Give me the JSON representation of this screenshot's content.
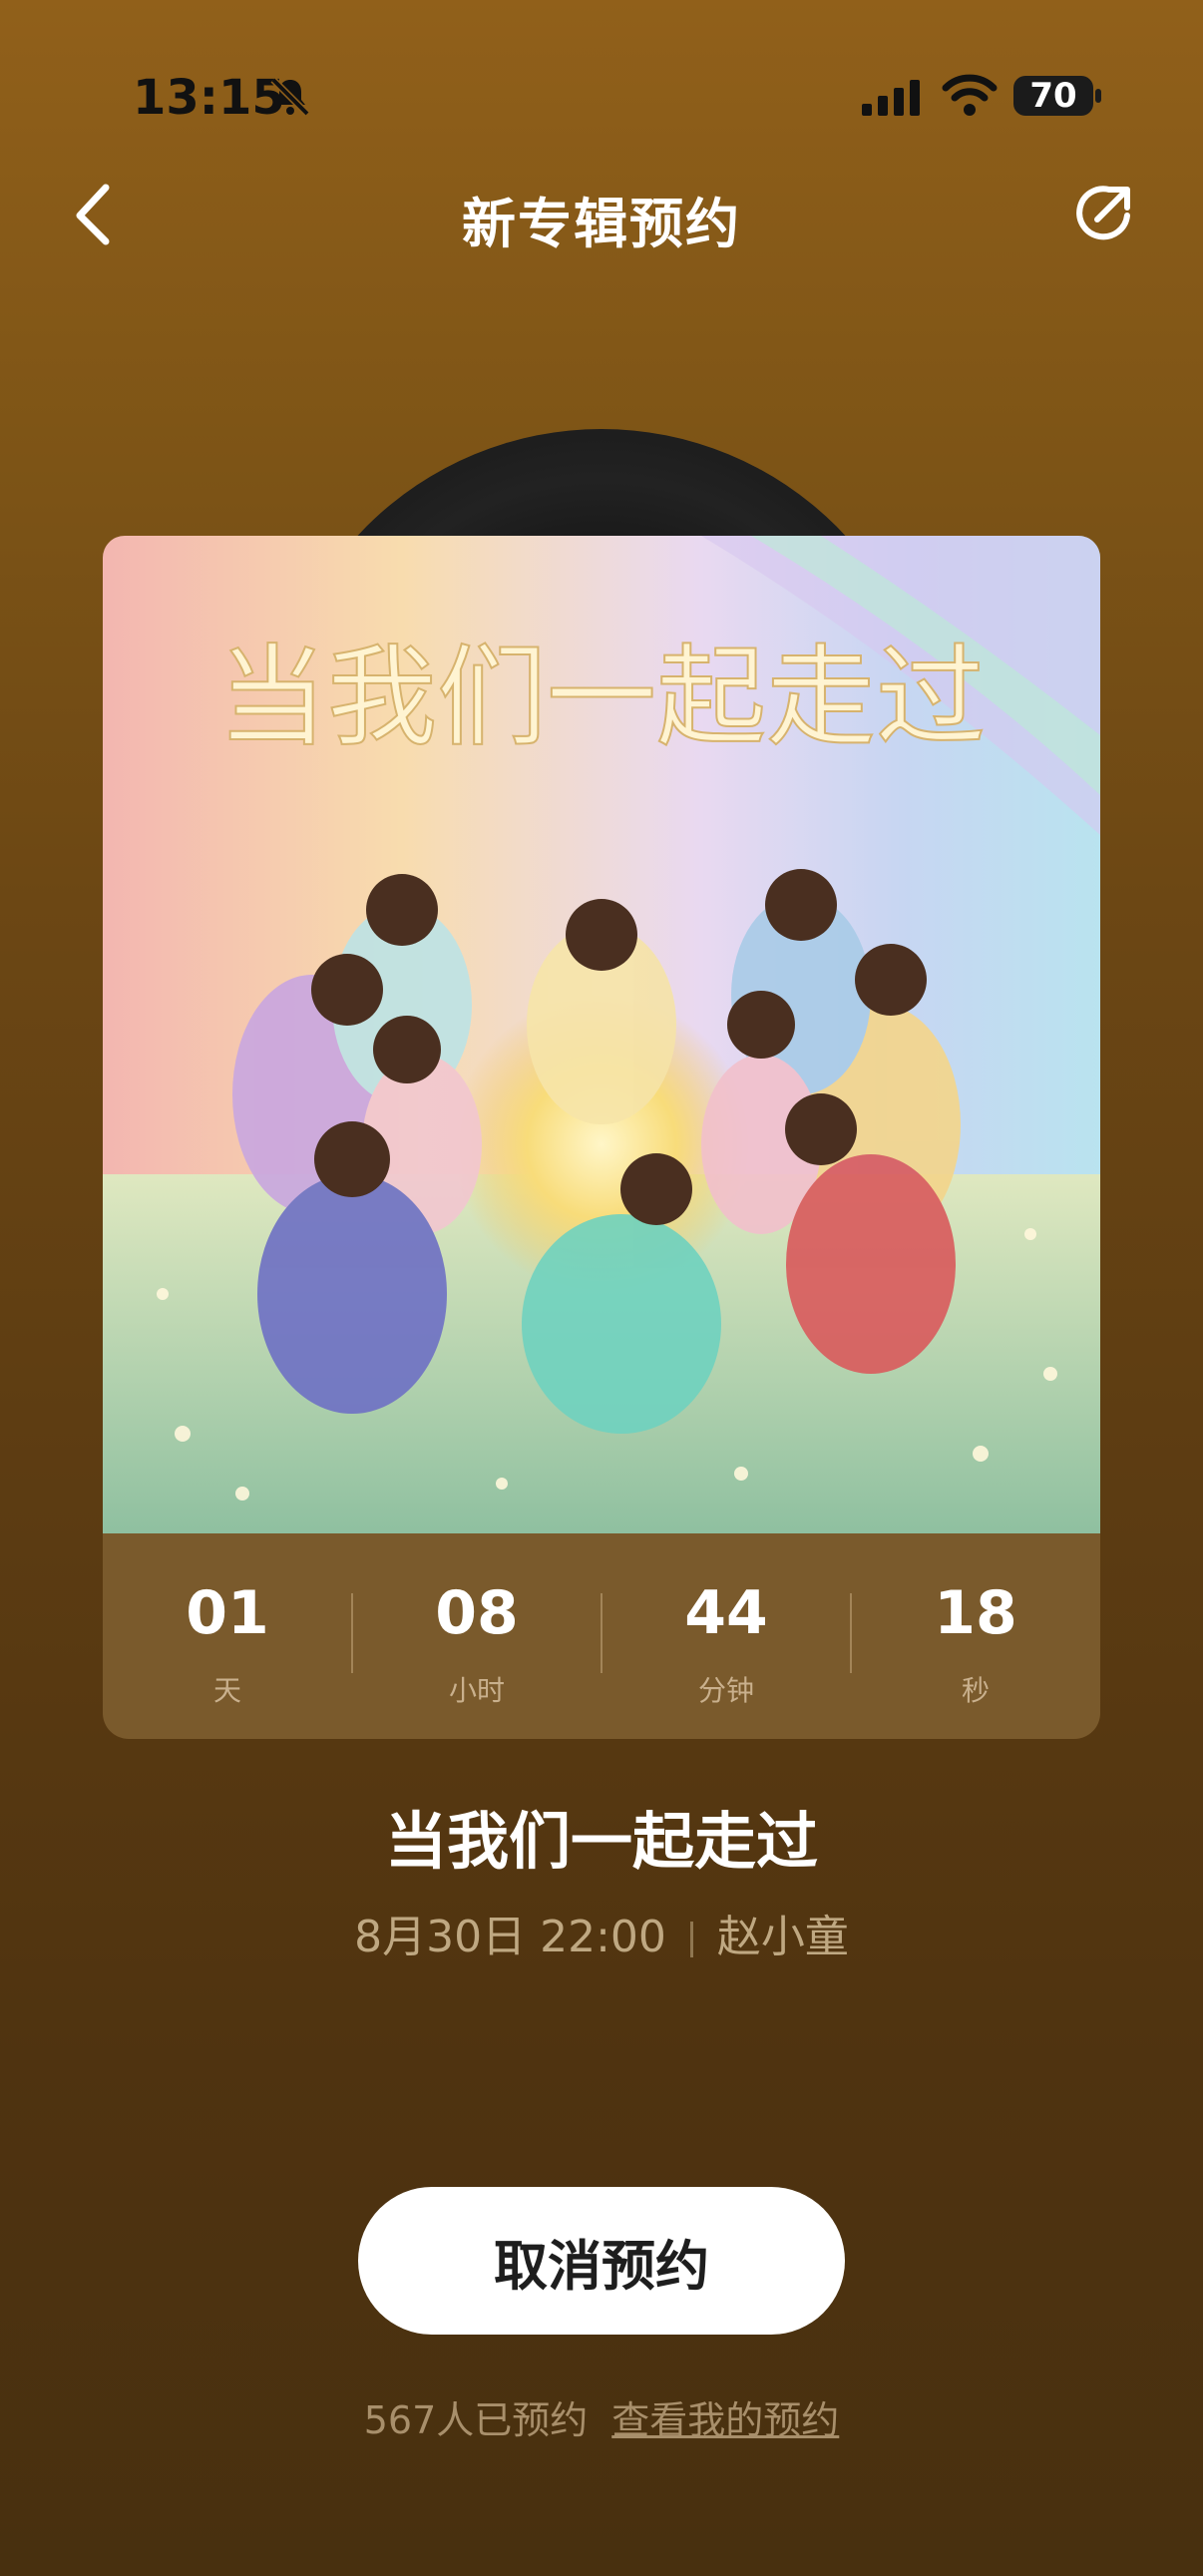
{
  "status_bar": {
    "time": "13:15",
    "battery": "70",
    "bell_icon": "bell-muted-icon",
    "signal_icon": "signal-icon",
    "wifi_icon": "wifi-icon"
  },
  "nav": {
    "title": "新专辑预约",
    "back_icon": "chevron-left-icon",
    "share_icon": "share-icon"
  },
  "album": {
    "cover_title": "当我们一起走过",
    "title": "当我们一起走过",
    "release": "8月30日 22:00",
    "artist": "赵小童"
  },
  "countdown": [
    {
      "value": "01",
      "unit": "天"
    },
    {
      "value": "08",
      "unit": "小时"
    },
    {
      "value": "44",
      "unit": "分钟"
    },
    {
      "value": "18",
      "unit": "秒"
    }
  ],
  "actions": {
    "cancel_label": "取消预约"
  },
  "footer": {
    "count_text": "567人已预约",
    "link_text": "查看我的预约"
  },
  "colors": {
    "accent": "#7a5a2c",
    "background_top": "#91601a",
    "background_bottom": "#48300f"
  }
}
